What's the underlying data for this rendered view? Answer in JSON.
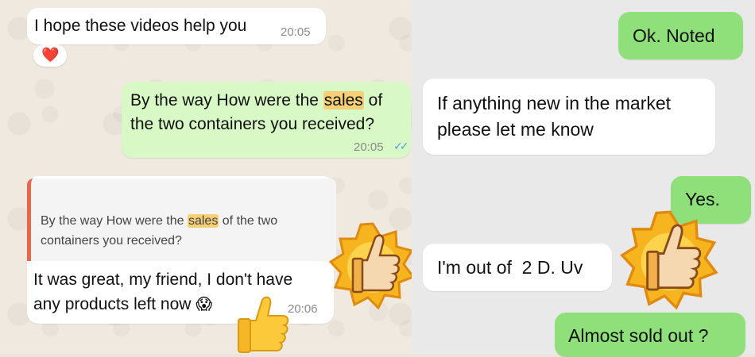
{
  "left_chat": {
    "msg1": {
      "text": "I hope these videos help you",
      "time": "20:05",
      "reaction": "❤️"
    },
    "msg2": {
      "pre": "By the way How were the ",
      "highlight": "sales",
      "post": " of",
      "line2": "the two containers you received?",
      "time": "20:05",
      "ticks": "✓✓"
    },
    "msg3": {
      "quote_pre": "By the way How were the ",
      "quote_highlight": "sales",
      "quote_post": " of the two",
      "quote_line2": "containers you received?",
      "line1": "It was great, my friend, I don't have",
      "line2": "any products left now",
      "emoji": "😱",
      "time": "20:06"
    }
  },
  "right_chat": {
    "msg1": {
      "text": "Ok. Noted"
    },
    "msg2": {
      "line1": "If anything new in the market",
      "line2": "please let me know"
    },
    "msg3": {
      "text": "Yes."
    },
    "msg4": {
      "text": "I'm out of  2 D. Uv"
    },
    "msg5": {
      "text": "Almost sold out ?"
    }
  },
  "colors": {
    "highlight": "#f6cf77",
    "outgoing_left": "#d8f8c6",
    "outgoing_right": "#8fe07a",
    "quote_bar": "#e8674a",
    "read_ticks": "#4aa3e8"
  },
  "icons": [
    "heart-reaction-icon",
    "thumbs-up-badge-icon",
    "thumbs-up-icon",
    "read-ticks-icon"
  ]
}
